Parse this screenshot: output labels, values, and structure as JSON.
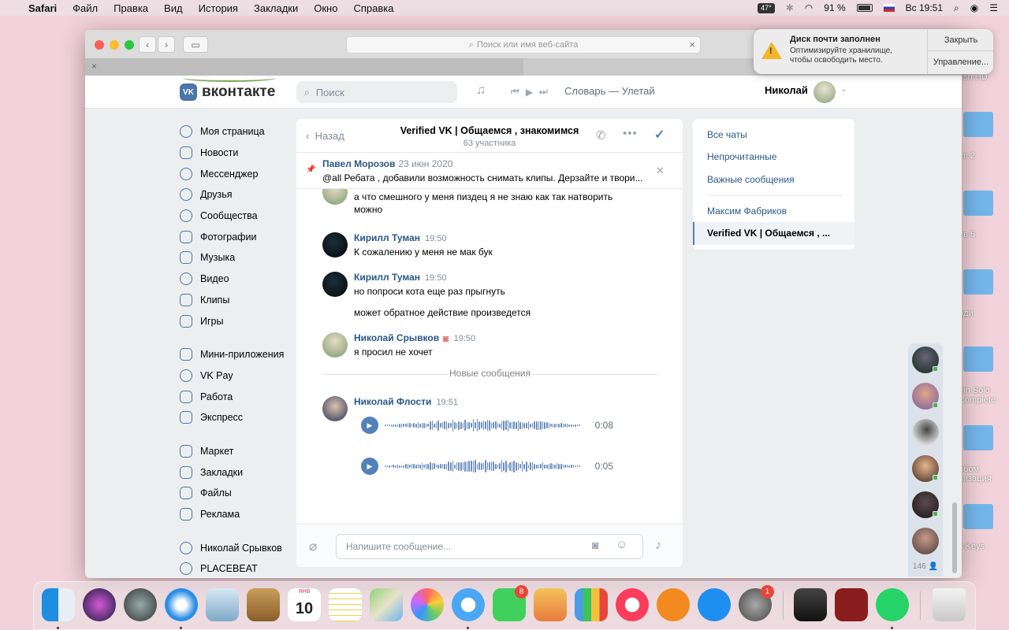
{
  "menubar": {
    "apple": "",
    "app": "Safari",
    "items": [
      "Файл",
      "Правка",
      "Вид",
      "История",
      "Закладки",
      "Окно",
      "Справка"
    ],
    "temp": "47°",
    "battery": "91 %",
    "lang": "RU",
    "clock": "Вс 19:51"
  },
  "browser": {
    "url_placeholder": "Поиск или имя веб-сайта",
    "close_tab": "×"
  },
  "vk": {
    "logo_mark": "VK",
    "logo_text": "вконтакте",
    "search_placeholder": "Поиск",
    "track": "Словарь — Улетай",
    "user_name": "Николай"
  },
  "nav": {
    "items": [
      "Моя страница",
      "Новости",
      "Мессенджер",
      "Друзья",
      "Сообщества",
      "Фотографии",
      "Музыка",
      "Видео",
      "Клипы",
      "Игры"
    ],
    "items2": [
      "Мини-приложения",
      "VK Pay",
      "Работа",
      "Экспресс"
    ],
    "items3": [
      "Маркет",
      "Закладки",
      "Файлы",
      "Реклама"
    ],
    "items4": [
      "Николай Срывков",
      "PLACEBEAT"
    ]
  },
  "chat": {
    "back": "Назад",
    "title": "Verified VK | Общаемся , знакомимся",
    "subtitle": "63 участника",
    "pinned": {
      "author": "Павел Морозов",
      "date": "23 июн 2020",
      "text": "@all Ребата , добавили возможность снимать клипы. Дерзайте и твори..."
    },
    "messages": [
      {
        "author": "",
        "time": "",
        "text": "а что смешного у меня пиздец я не знаю как так натворить можно"
      },
      {
        "author": "Кирилл Туман",
        "time": "19:50",
        "text": "К сожалению у меня не мак бук"
      },
      {
        "author": "Кирилл Туман",
        "time": "19:50",
        "text": "но попроси кота еще раз прыгнуть",
        "text2": "может обратное действие произведется"
      },
      {
        "author": "Николай Срывков",
        "time": "19:50",
        "text": "я просил не хочет"
      },
      {
        "author": "Николай Флости",
        "time": "19:51",
        "voice": [
          {
            "duration": "0:08"
          },
          {
            "duration": "0:05"
          }
        ]
      }
    ],
    "new_divider": "Новые сообщения",
    "composer_placeholder": "Напишите сообщение..."
  },
  "right_panel": {
    "items": [
      "Все чаты",
      "Непрочитанные",
      "Важные сообщения"
    ],
    "recent": [
      "Максим Фабриков",
      "Verified VK | Общаемся , ..."
    ]
  },
  "bubbles": {
    "count": "146"
  },
  "notification": {
    "title": "Диск почти заполнен",
    "body": "Оптимизируйте хранилище, чтобы освободить место.",
    "close": "Закрыть",
    "manage": "Управление..."
  },
  "desktop": {
    "labels": [
      "osh HD",
      "ив 2",
      "ив 5",
      "ади",
      "ein Solo Complete",
      "обом визация",
      "s Keys"
    ]
  },
  "dock": {
    "calendar_month": "ЯНВ",
    "calendar_day": "10",
    "badge_facetime": "8",
    "badge_prefs": "1"
  }
}
